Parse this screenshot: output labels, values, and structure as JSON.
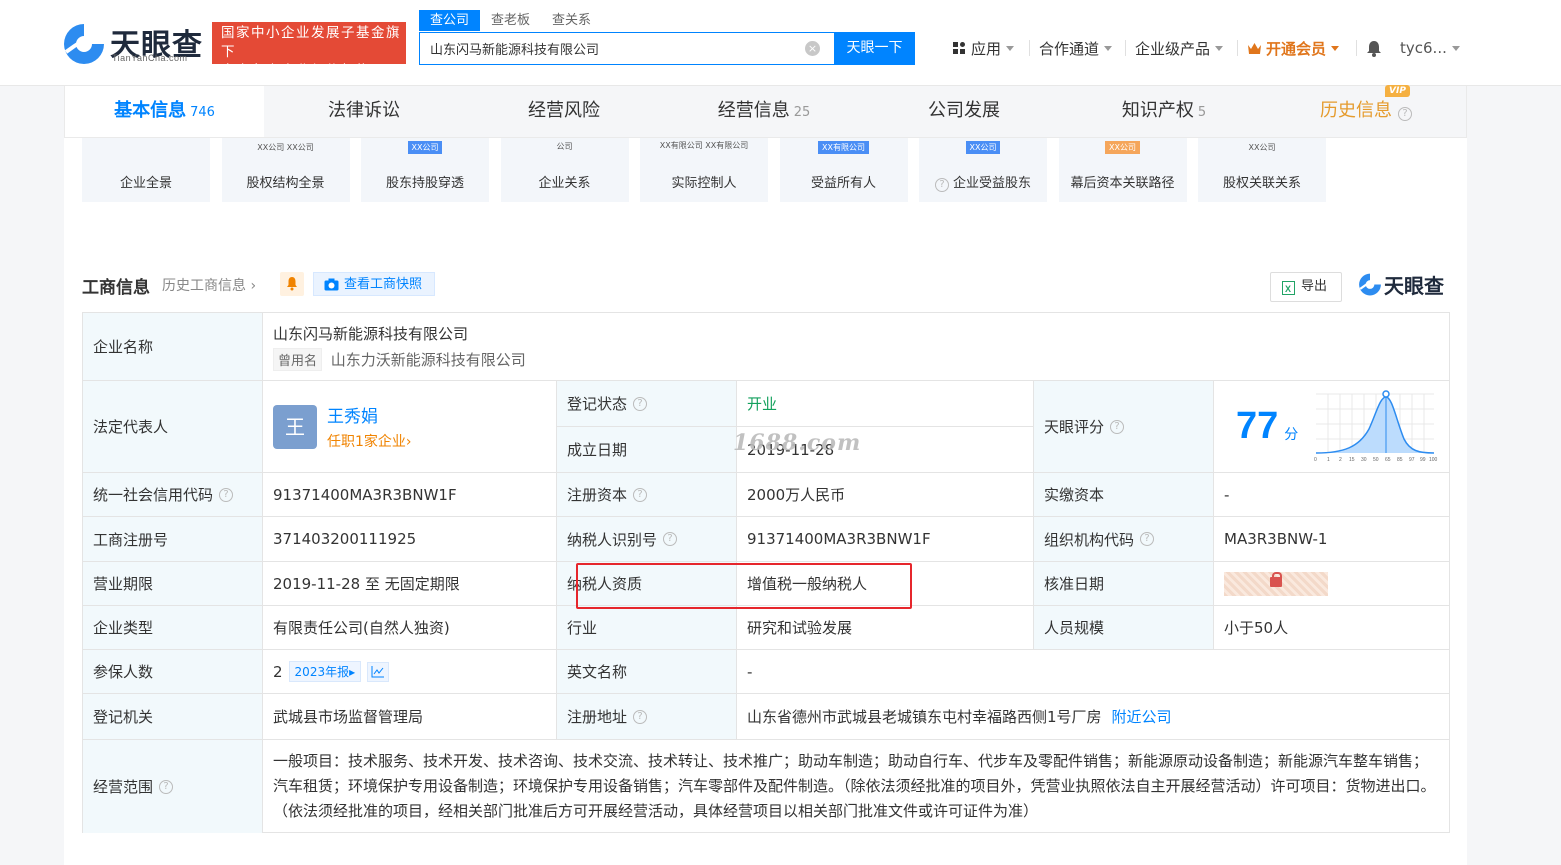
{
  "header": {
    "logo_text": "天眼查",
    "logo_sub": "TianYanCha.com",
    "slogan_line1": "国家中小企业发展子基金旗下",
    "slogan_line2": "官方备案企业征信机构",
    "search_tabs": [
      "查公司",
      "查老板",
      "查关系"
    ],
    "search_value": "山东闪马新能源科技有限公司",
    "search_button": "天眼一下",
    "nav": {
      "apps": "应用",
      "partner": "合作通道",
      "enterprise": "企业级产品",
      "vip": "开通会员",
      "user": "tyc6..."
    }
  },
  "tabs": [
    {
      "label": "基本信息",
      "count": "746"
    },
    {
      "label": "法律诉讼",
      "count": ""
    },
    {
      "label": "经营风险",
      "count": ""
    },
    {
      "label": "经营信息",
      "count": "25"
    },
    {
      "label": "公司发展",
      "count": ""
    },
    {
      "label": "知识产权",
      "count": "5"
    },
    {
      "label": "历史信息",
      "count": ""
    }
  ],
  "vip_badge": "VIP",
  "thumbs": [
    {
      "label": "企业全景",
      "mini": ""
    },
    {
      "label": "股权结构全景",
      "mini": "XX公司  XX公司"
    },
    {
      "label": "股东持股穿透",
      "mini": "XX公司"
    },
    {
      "label": "企业关系",
      "mini": "公司"
    },
    {
      "label": "实际控制人",
      "mini": "XX有限公司 XX有限公司"
    },
    {
      "label": "受益所有人",
      "mini": "XX有限公司"
    },
    {
      "label": "企业受益股东",
      "mini": "XX公司"
    },
    {
      "label": "幕后资本关联路径",
      "mini": "XX公司"
    },
    {
      "label": "股权关联关系",
      "mini": "XX公司"
    }
  ],
  "section": {
    "title": "工商信息",
    "history_link": "历史工商信息",
    "snapshot_button": "查看工商快照",
    "export_button": "导出",
    "brand": "天眼查"
  },
  "watermark": "1688.com",
  "info": {
    "company_name_label": "企业名称",
    "company_name": "山东闪马新能源科技有限公司",
    "former_name_tag": "曾用名",
    "former_name": "山东力沃新能源科技有限公司",
    "legal_rep_label": "法定代表人",
    "legal_rep_avatar": "王",
    "legal_rep_name": "王秀娟",
    "legal_rep_link": "任职1家企业",
    "reg_status_label": "登记状态",
    "reg_status": "开业",
    "established_label": "成立日期",
    "established": "2019-11-28",
    "score_label": "天眼评分",
    "score": "77",
    "score_unit": "分",
    "credit_code_label": "统一社会信用代码",
    "credit_code": "91371400MA3R3BNW1F",
    "reg_capital_label": "注册资本",
    "reg_capital": "2000万人民币",
    "paid_capital_label": "实缴资本",
    "paid_capital": "-",
    "reg_no_label": "工商注册号",
    "reg_no": "371403200111925",
    "tax_id_label": "纳税人识别号",
    "tax_id": "91371400MA3R3BNW1F",
    "org_code_label": "组织机构代码",
    "org_code": "MA3R3BNW-1",
    "term_label": "营业期限",
    "term": "2019-11-28 至 无固定期限",
    "taxpayer_label": "纳税人资质",
    "taxpayer": "增值税一般纳税人",
    "approval_label": "核准日期",
    "type_label": "企业类型",
    "type": "有限责任公司(自然人独资)",
    "industry_label": "行业",
    "industry": "研究和试验发展",
    "staff_label": "人员规模",
    "staff": "小于50人",
    "insured_label": "参保人数",
    "insured": "2",
    "insured_report": "2023年报",
    "english_label": "英文名称",
    "english": "-",
    "authority_label": "登记机关",
    "authority": "武城县市场监督管理局",
    "address_label": "注册地址",
    "address": "山东省德州市武城县老城镇东屯村幸福路西侧1号厂房",
    "nearby": "附近公司",
    "scope_label": "经营范围",
    "scope": "一般项目：技术服务、技术开发、技术咨询、技术交流、技术转让、技术推广；助动车制造；助动自行车、代步车及零配件销售；新能源原动设备制造；新能源汽车整车销售；汽车租赁；环境保护专用设备制造；环境保护专用设备销售；汽车零部件及配件制造。（除依法须经批准的项目外，凭营业执照依法自主开展经营活动）许可项目：货物进出口。（依法须经批准的项目，经相关部门批准后方可开展经营活动，具体经营项目以相关部门批准文件或许可证件为准）"
  },
  "score_chart": {
    "x_ticks": [
      "0",
      "1",
      "2",
      "15",
      "30",
      "50",
      "65",
      "85",
      "97",
      "99",
      "100"
    ]
  },
  "colors": {
    "accent": "#0084ff",
    "status_green": "#12a05c",
    "highlight_red": "#e6262c",
    "slogan_red": "#e44a36",
    "history_orange": "#e59b2d"
  }
}
